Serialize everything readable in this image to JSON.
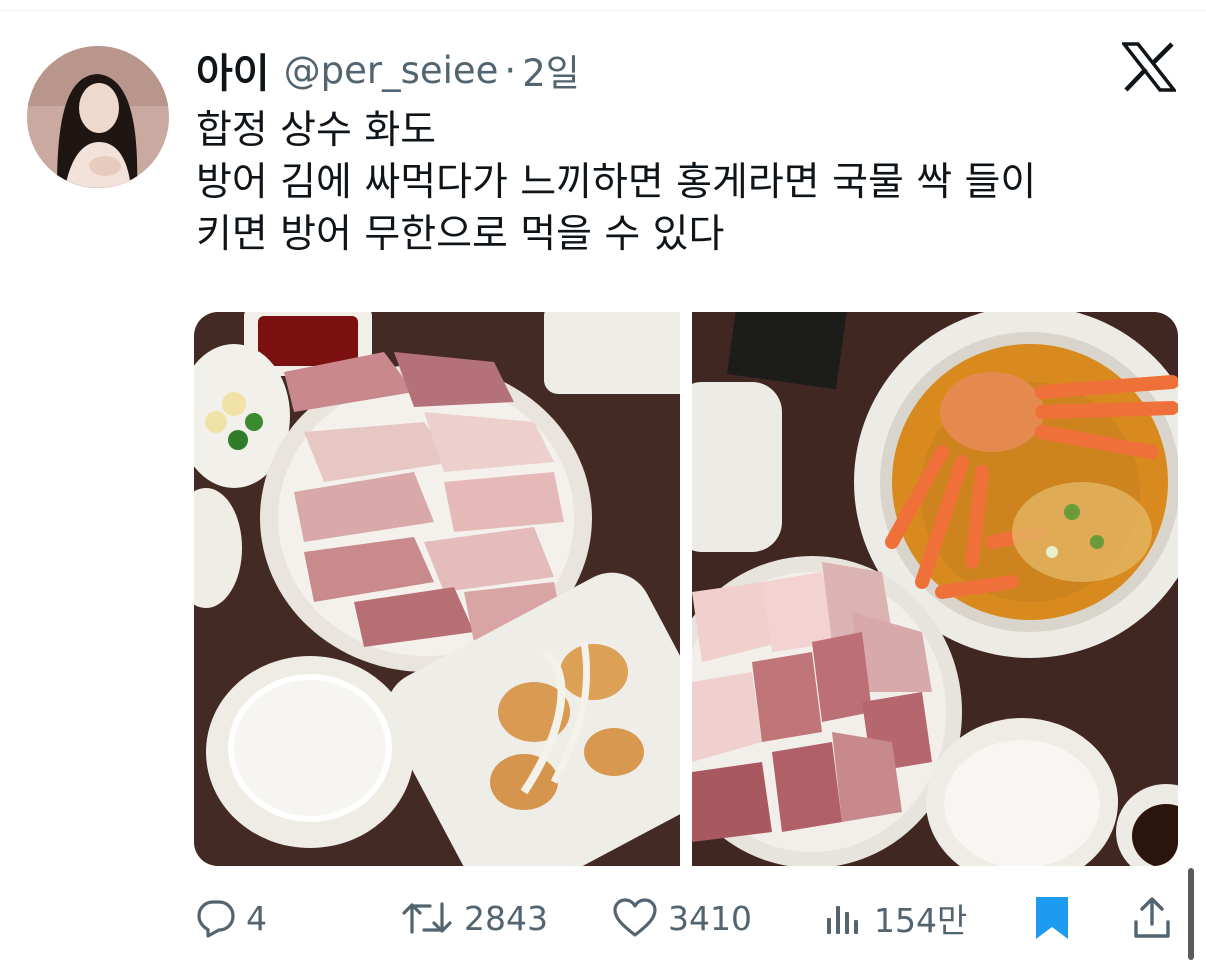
{
  "author": {
    "name": "아이",
    "handle": "@per_seiee",
    "separator": "·",
    "time": "2일"
  },
  "tweet": {
    "lines": [
      "합정 상수 화도",
      "방어 김에 싸먹다가 느끼하면 홍게라면 국물 싹 들이",
      "키면 방어 무한으로 먹을 수 있다"
    ]
  },
  "media": {
    "photos": [
      {
        "subject": "yellowtail sashimi platter with rice and fried shrimp"
      },
      {
        "subject": "yellowtail sashimi with snow crab ramen and rice"
      }
    ]
  },
  "actions": {
    "replies": "4",
    "retweets": "2843",
    "likes": "3410",
    "views": "154만"
  },
  "icons": {
    "platform": "x-logo-icon",
    "reply": "reply-icon",
    "retweet": "retweet-icon",
    "like": "heart-icon",
    "views": "views-icon",
    "bookmark": "bookmark-icon",
    "share": "share-icon"
  },
  "colors": {
    "text": "#0f1419",
    "secondary": "#536471",
    "bookmark_active": "#1d9bf0"
  }
}
